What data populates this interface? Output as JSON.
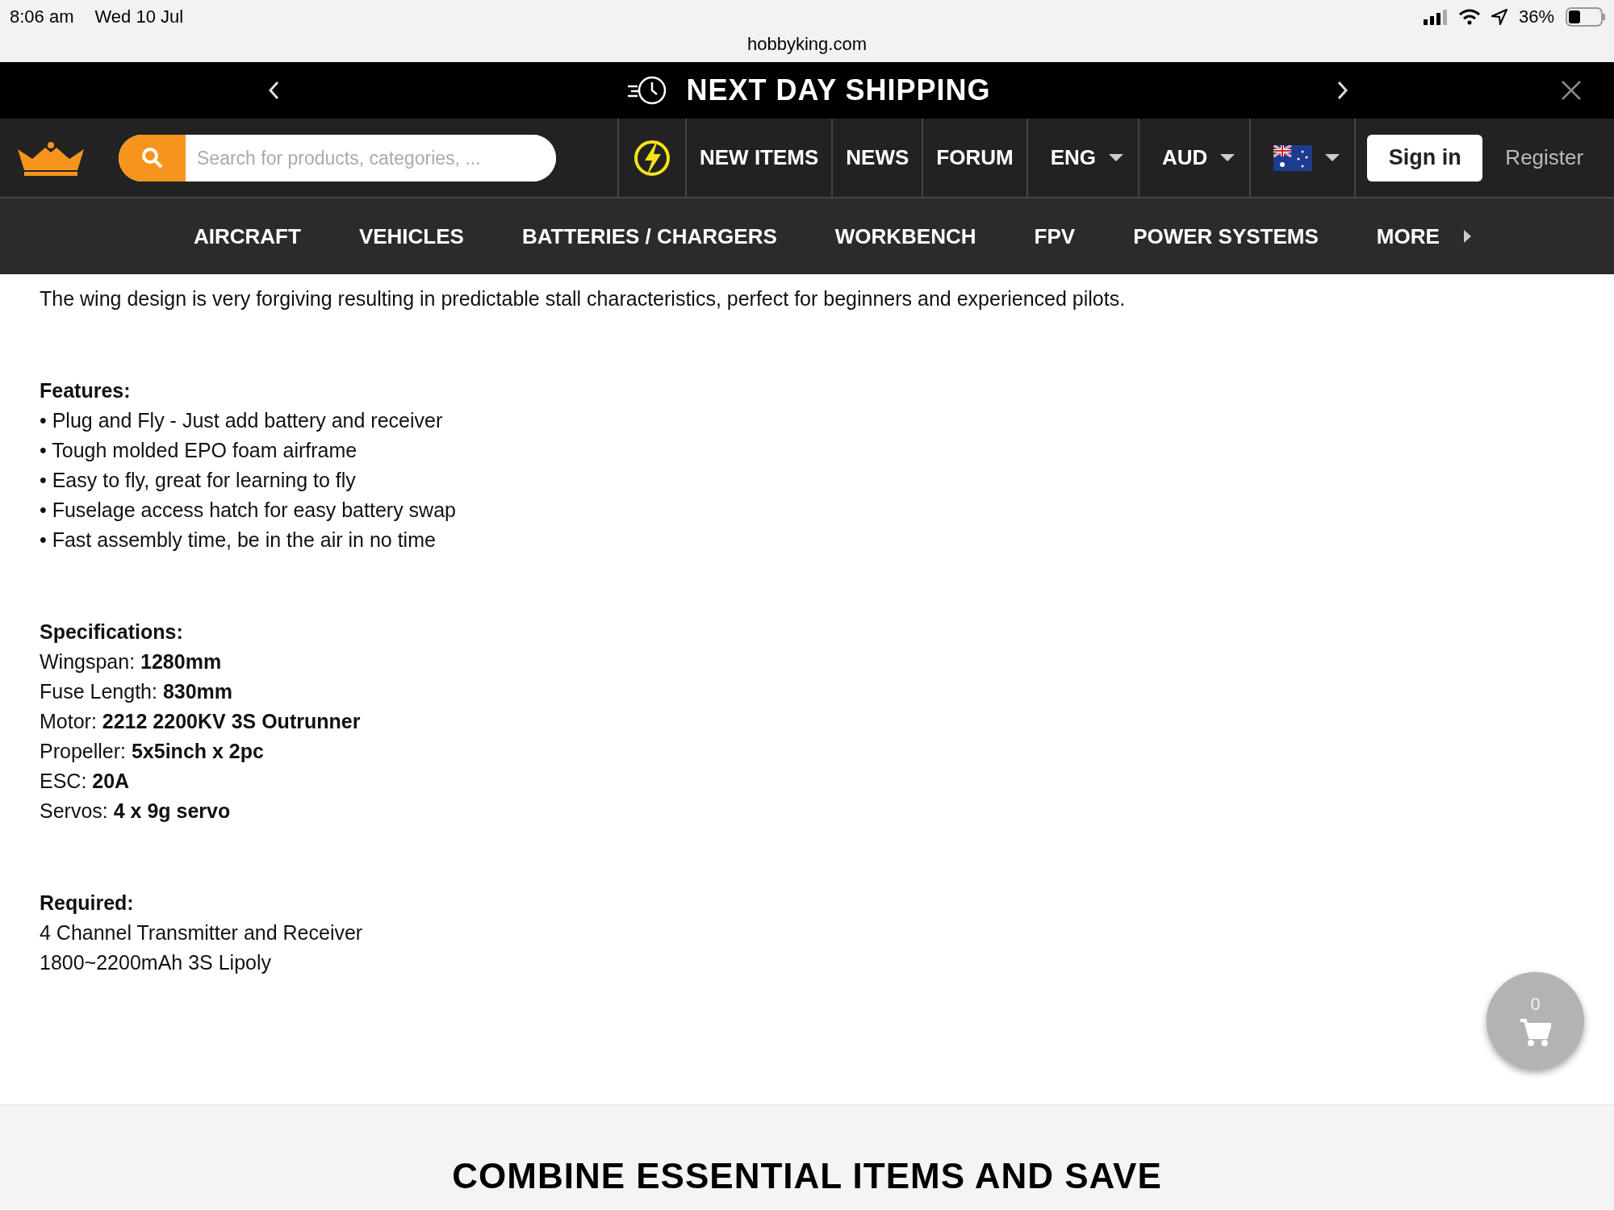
{
  "status_bar": {
    "time": "8:06 am",
    "date": "Wed 10 Jul",
    "battery": "36%"
  },
  "browser": {
    "url": "hobbyking.com"
  },
  "promo_bar": {
    "text": "NEXT DAY SHIPPING"
  },
  "header": {
    "search": {
      "placeholder": "Search for products, categories, ..."
    },
    "links": [
      "NEW ITEMS",
      "NEWS",
      "FORUM"
    ],
    "dropdowns": [
      {
        "kind": "text",
        "label": "ENG"
      },
      {
        "kind": "text",
        "label": "AUD"
      },
      {
        "kind": "flag"
      }
    ],
    "sign_in": "Sign in",
    "register": "Register"
  },
  "categories": [
    {
      "kind": "link",
      "label": "AIRCRAFT"
    },
    {
      "kind": "link",
      "label": "VEHICLES"
    },
    {
      "kind": "link",
      "label": "BATTERIES / CHARGERS"
    },
    {
      "kind": "link",
      "label": "WORKBENCH"
    },
    {
      "kind": "link",
      "label": "FPV"
    },
    {
      "kind": "link",
      "label": "POWER SYSTEMS"
    },
    {
      "kind": "menu",
      "label": "MORE"
    }
  ],
  "description": {
    "paragraph": "The wing design is very forgiving resulting in predictable stall characteristics, perfect for beginners and experienced pilots.",
    "sections": [
      {
        "heading": "Features:",
        "lines": [
          "• Plug and Fly - Just add battery and receiver",
          "• Tough molded EPO foam airframe",
          "• Easy to fly, great for learning to fly",
          "• Fuselage access hatch for easy battery swap",
          "• Fast assembly time, be in the air in no time"
        ]
      },
      {
        "heading": "Specifications:",
        "lines": [
          "Wingspan: **1280mm**",
          "Fuse Length: **830mm**",
          "Motor: **2212 2200KV 3S Outrunner**",
          "Propeller: **5x5inch x 2pc**",
          "ESC: **20A**",
          "Servos: **4 x 9g servo**"
        ]
      },
      {
        "heading": "Required:",
        "lines": [
          "4 Channel Transmitter and Receiver",
          "1800~2200mAh 3S Lipoly"
        ]
      }
    ]
  },
  "cart": {
    "count": "0"
  },
  "footer": {
    "heading": "COMBINE ESSENTIAL ITEMS AND SAVE"
  }
}
